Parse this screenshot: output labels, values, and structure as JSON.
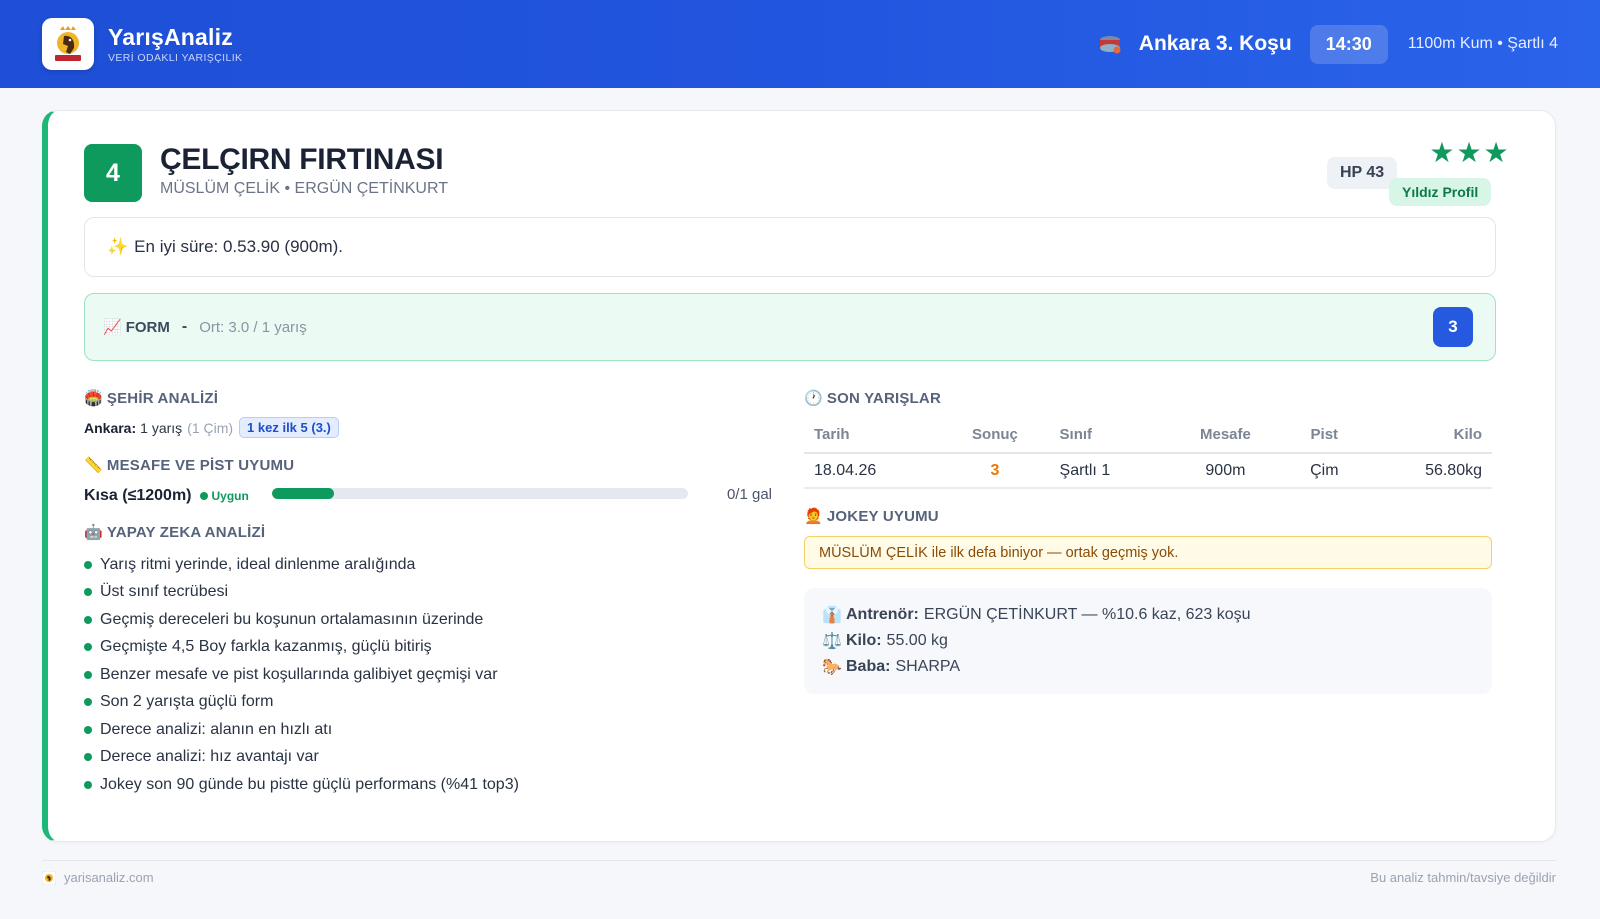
{
  "brand": {
    "name": "YarışAnaliz",
    "tagline": "VERİ ODAKLI YARIŞÇILIK",
    "logo_text": "YARIŞ ANALİZ"
  },
  "race": {
    "title": "Ankara 3. Koşu",
    "time": "14:30",
    "info": "1100m Kum • Şartlı 4"
  },
  "horse": {
    "number": "4",
    "name": "ÇELÇIRN FIRTINASI",
    "subtitle": "MÜSLÜM ÇELİK • ERGÜN ÇETİNKURT",
    "hp": "HP 43",
    "stars": "★★★",
    "star_label": "Yıldız Profil"
  },
  "best_time": "En iyi süre: 0.53.90 (900m).",
  "form": {
    "label": "FORM",
    "dash": "-",
    "avg": "Ort: 3.0 / 1 yarış",
    "score": "3"
  },
  "city": {
    "title": "ŞEHİR ANALİZİ",
    "city_name": "Ankara:",
    "count": "1 yarış",
    "surface": "(1 Çim)",
    "pill": "1 kez ilk 5 (3.)"
  },
  "distance": {
    "title": "MESAFE VE PİST UYUMU",
    "label": "Kısa (≤1200m)",
    "status": "Uygun",
    "bar_fill": 0.15,
    "value": "0/1 gal"
  },
  "ai": {
    "title": "YAPAY ZEKA ANALİZİ",
    "items": [
      "Yarış ritmi yerinde, ideal dinlenme aralığında",
      "Üst sınıf tecrübesi",
      "Geçmiş dereceleri bu koşunun ortalamasının üzerinde",
      "Geçmişte 4,5 Boy farkla kazanmış, güçlü bitiriş",
      "Benzer mesafe ve pist koşullarında galibiyet geçmişi var",
      "Son 2 yarışta güçlü form",
      "Derece analizi: alanın en hızlı atı",
      "Derece analizi: hız avantajı var",
      "Jokey son 90 günde bu pistte güçlü performans (%41 top3)"
    ]
  },
  "recent": {
    "title": "SON YARIŞLAR",
    "headers": [
      "Tarih",
      "Sonuç",
      "Sınıf",
      "Mesafe",
      "Pist",
      "Kilo"
    ],
    "rows": [
      [
        "18.04.26",
        "3",
        "Şartlı 1",
        "900m",
        "Çim",
        "56.80kg"
      ]
    ]
  },
  "jockey": {
    "title": "JOKEY UYUMU",
    "warning": "MÜSLÜM ÇELİK ile ilk defa biniyor — ortak geçmiş yok."
  },
  "details": {
    "trainer_label": "Antrenör:",
    "trainer_value": "ERGÜN ÇETİNKURT — %10.6 kaz, 623 koşu",
    "weight_label": "Kilo:",
    "weight_value": "55.00 kg",
    "sire_label": "Baba:",
    "sire_value": "SHARPA"
  },
  "footer": {
    "site": "yarisanaliz.com",
    "disclaimer": "Bu analiz tahmin/tavsiye değildir"
  },
  "colors": {
    "header": "#2255df",
    "accent_green": "#0f9a5d",
    "score_blue": "#2459e0",
    "result_orange": "#e8780c"
  }
}
